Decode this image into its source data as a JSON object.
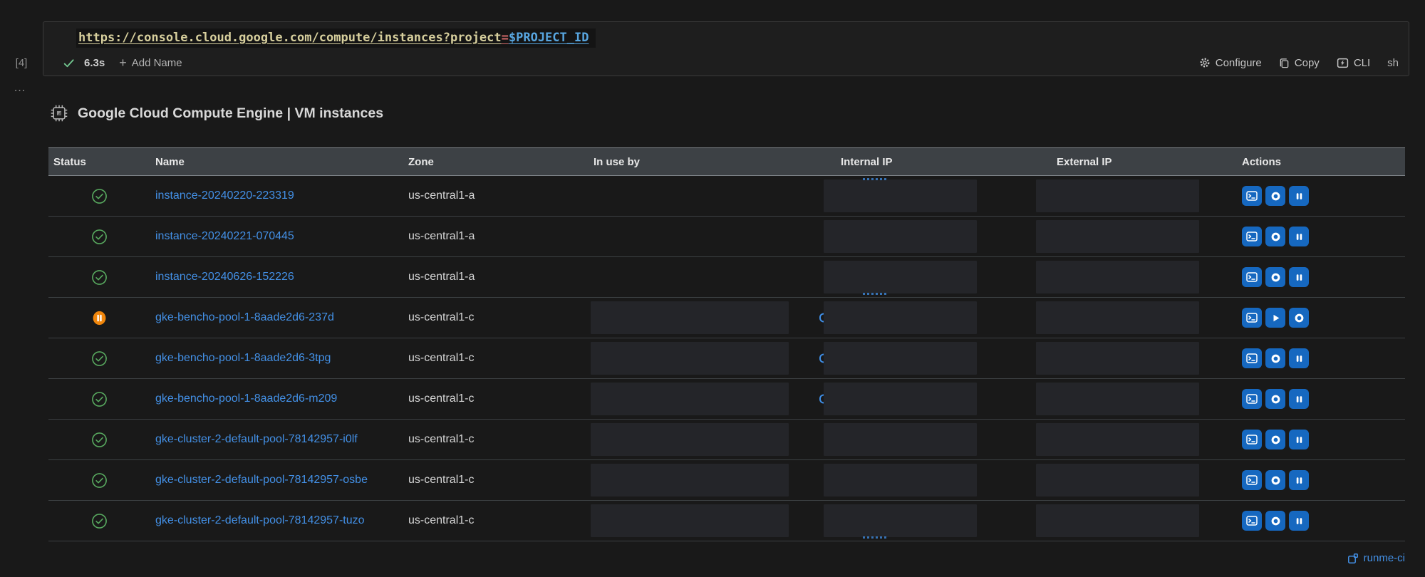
{
  "cell": {
    "execution_count": "[4]",
    "code": {
      "url_text": "https://console.cloud.google.com/compute/instances?project",
      "operator": "=",
      "variable": "$PROJECT_ID"
    },
    "status_bar": {
      "duration": "6.3s",
      "add_name_label": "Add Name"
    },
    "toolbar": {
      "configure_label": "Configure",
      "copy_label": "Copy",
      "cli_label": "CLI",
      "language_label": "sh"
    },
    "more_indicator": "…"
  },
  "icons": {
    "plus": "+"
  },
  "output": {
    "title": "Google Cloud Compute Engine | VM instances",
    "table": {
      "columns": [
        "Status",
        "Name",
        "Zone",
        "In use by",
        "Internal IP",
        "External IP",
        "Actions"
      ],
      "rows": [
        {
          "status": "running",
          "name": "instance-20240220-223319",
          "zone": "us-central1-a",
          "in_use_redacted": false,
          "internal_redacted": true,
          "external_redacted": true,
          "peek": "top-dots",
          "actions": [
            "terminal",
            "stop",
            "suspend"
          ]
        },
        {
          "status": "running",
          "name": "instance-20240221-070445",
          "zone": "us-central1-a",
          "in_use_redacted": false,
          "internal_redacted": true,
          "external_redacted": true,
          "peek": null,
          "actions": [
            "terminal",
            "stop",
            "suspend"
          ]
        },
        {
          "status": "running",
          "name": "instance-20240626-152226",
          "zone": "us-central1-a",
          "in_use_redacted": false,
          "internal_redacted": true,
          "external_redacted": true,
          "peek": "bottom-dots",
          "actions": [
            "terminal",
            "stop",
            "suspend"
          ]
        },
        {
          "status": "suspended",
          "name": "gke-bencho-pool-1-8aade2d6-237d",
          "zone": "us-central1-c",
          "in_use_redacted": true,
          "internal_redacted": true,
          "external_redacted": true,
          "peek": "paren",
          "actions": [
            "terminal",
            "resume",
            "stop"
          ]
        },
        {
          "status": "running",
          "name": "gke-bencho-pool-1-8aade2d6-3tpg",
          "zone": "us-central1-c",
          "in_use_redacted": true,
          "internal_redacted": true,
          "external_redacted": true,
          "peek": "paren",
          "actions": [
            "terminal",
            "stop",
            "suspend"
          ]
        },
        {
          "status": "running",
          "name": "gke-bencho-pool-1-8aade2d6-m209",
          "zone": "us-central1-c",
          "in_use_redacted": true,
          "internal_redacted": true,
          "external_redacted": true,
          "peek": "paren",
          "actions": [
            "terminal",
            "stop",
            "suspend"
          ]
        },
        {
          "status": "running",
          "name": "gke-cluster-2-default-pool-78142957-i0lf",
          "zone": "us-central1-c",
          "in_use_redacted": true,
          "internal_redacted": true,
          "external_redacted": true,
          "peek": null,
          "actions": [
            "terminal",
            "stop",
            "suspend"
          ]
        },
        {
          "status": "running",
          "name": "gke-cluster-2-default-pool-78142957-osbe",
          "zone": "us-central1-c",
          "in_use_redacted": true,
          "internal_redacted": true,
          "external_redacted": true,
          "peek": null,
          "actions": [
            "terminal",
            "stop",
            "suspend"
          ]
        },
        {
          "status": "running",
          "name": "gke-cluster-2-default-pool-78142957-tuzo",
          "zone": "us-central1-c",
          "in_use_redacted": true,
          "internal_redacted": true,
          "external_redacted": true,
          "peek": "bottom-dots",
          "actions": [
            "terminal",
            "stop",
            "suspend"
          ]
        }
      ]
    },
    "footer": {
      "label": "runme-ci"
    }
  },
  "colors": {
    "page_background": "#191919",
    "cell_background": "#1e1e1e",
    "header_background": "#3d4145",
    "link_blue": "#4390e6",
    "action_button_blue": "#1668c0",
    "running_green": "#58a95f",
    "suspended_orange": "#f0860c",
    "code_string": "#d7cf9d",
    "code_operator": "#d16969",
    "code_variable": "#58a6e0",
    "redaction_box": "#242529"
  }
}
